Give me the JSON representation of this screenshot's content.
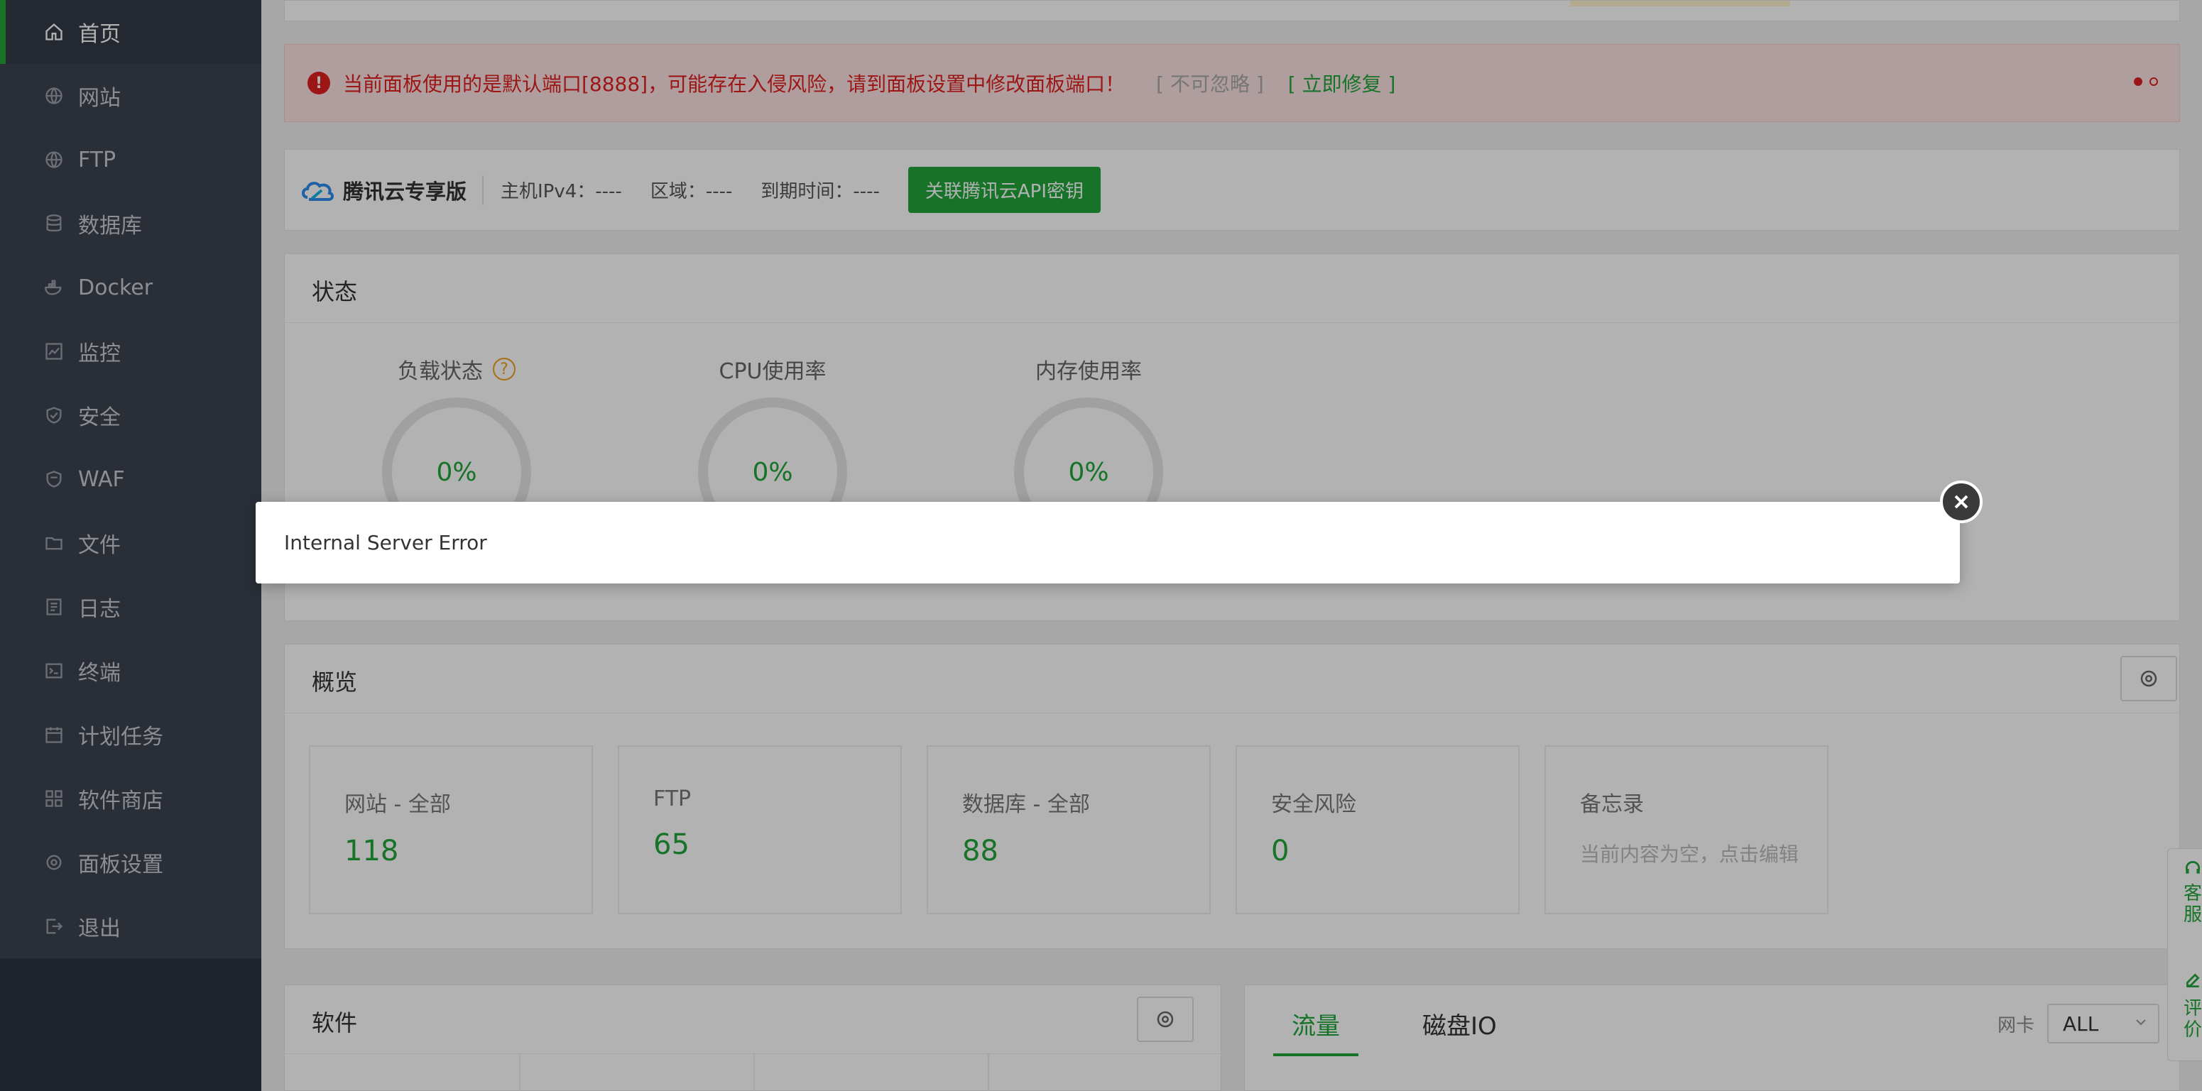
{
  "sidebar": {
    "items": [
      {
        "label": "首页",
        "icon": "home-icon",
        "active": true
      },
      {
        "label": "网站",
        "icon": "globe-icon"
      },
      {
        "label": "FTP",
        "icon": "globe-icon"
      },
      {
        "label": "数据库",
        "icon": "database-icon"
      },
      {
        "label": "Docker",
        "icon": "docker-icon"
      },
      {
        "label": "监控",
        "icon": "monitor-icon"
      },
      {
        "label": "安全",
        "icon": "shield-icon"
      },
      {
        "label": "WAF",
        "icon": "waf-shield-icon"
      },
      {
        "label": "文件",
        "icon": "folder-icon"
      },
      {
        "label": "日志",
        "icon": "log-icon"
      },
      {
        "label": "终端",
        "icon": "terminal-icon"
      },
      {
        "label": "计划任务",
        "icon": "calendar-icon"
      },
      {
        "label": "软件商店",
        "icon": "apps-icon"
      },
      {
        "label": "面板设置",
        "icon": "gear-icon"
      },
      {
        "label": "退出",
        "icon": "logout-icon"
      }
    ]
  },
  "warning": {
    "message": "当前面板使用的是默认端口[8888]，可能存在入侵风险，请到面板设置中修改面板端口！",
    "ignore": "[ 不可忽略 ]",
    "fix": "[ 立即修复 ]"
  },
  "cloud": {
    "brand": "腾讯云专享版",
    "ipv4": "主机IPv4：----",
    "region": "区域：----",
    "expire": "到期时间：----",
    "link_button": "关联腾讯云API密钥"
  },
  "status": {
    "title": "状态",
    "gauges": [
      {
        "name": "负载状态",
        "value": "0%",
        "help": "?"
      },
      {
        "name": "CPU使用率",
        "value": "0%"
      },
      {
        "name": "内存使用率",
        "value": "0%"
      }
    ]
  },
  "overview": {
    "title": "概览",
    "cards": [
      {
        "label": "网站 - 全部",
        "value": "118"
      },
      {
        "label": "FTP",
        "value": "65"
      },
      {
        "label": "数据库 - 全部",
        "value": "88"
      },
      {
        "label": "安全风险",
        "value": "0"
      },
      {
        "label": "备忘录",
        "memo": "当前内容为空，点击编辑"
      }
    ]
  },
  "software": {
    "title": "软件"
  },
  "traffic": {
    "tabs": [
      "流量",
      "磁盘IO"
    ],
    "nic_label": "网卡",
    "nic_value": "ALL"
  },
  "float": {
    "service": "客服",
    "review": "评价"
  },
  "modal": {
    "message": "Internal Server Error"
  },
  "colors": {
    "accent": "#20a53a",
    "danger": "#e02020",
    "sidebar": "#3d4450"
  }
}
